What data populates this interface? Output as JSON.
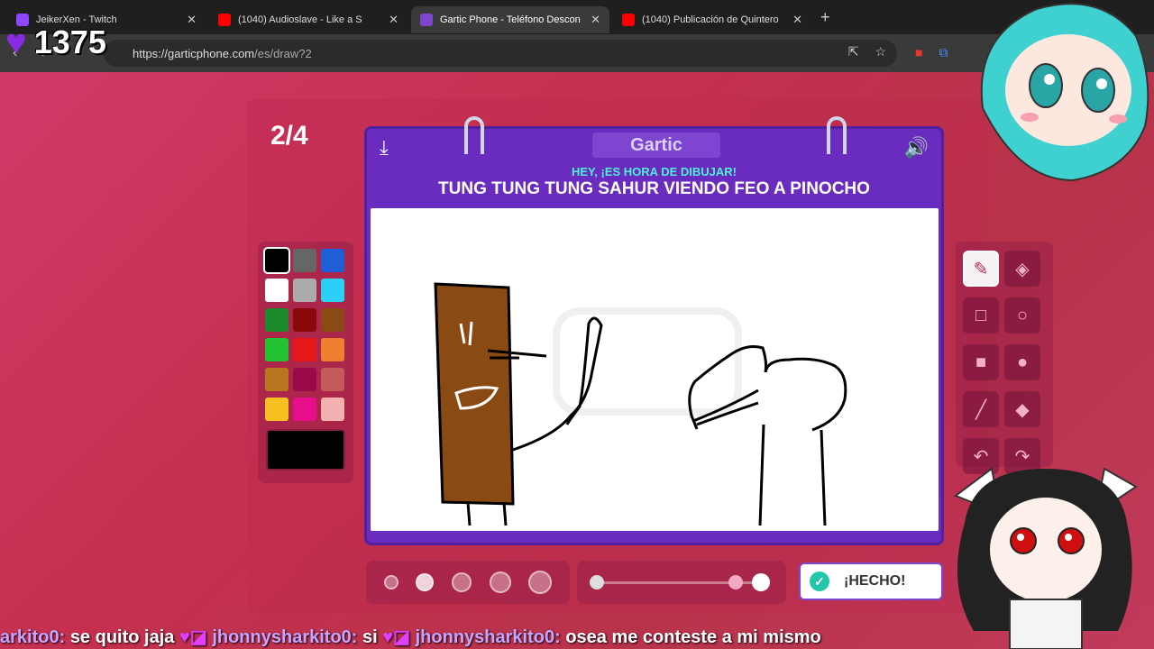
{
  "tabs": [
    {
      "title": "JeikerXen - Twitch",
      "favicon": "twitch-icon",
      "active": false
    },
    {
      "title": "(1040) Audioslave - Like a S",
      "favicon": "youtube-icon",
      "active": false
    },
    {
      "title": "Gartic Phone - Teléfono Descon",
      "favicon": "phone-icon",
      "active": true
    },
    {
      "title": "(1040) Publicación de Quintero",
      "favicon": "youtube-icon",
      "active": false
    }
  ],
  "url": {
    "host": "https://garticphone.com",
    "path": "/es/draw?2"
  },
  "stream": {
    "viewer_count": "1375"
  },
  "game": {
    "round": "2/4",
    "logo": "Gartic",
    "prompt_sub": "HEY, ¡ES HORA DE DIBUJAR!",
    "prompt_main": "TUNG TUNG TUNG SAHUR VIENDO FEO A PINOCHO",
    "done_label": "¡HECHO!",
    "watermark": "Gartic PHONE"
  },
  "palette": {
    "colors": [
      "#000000",
      "#666666",
      "#1f5fd6",
      "#ffffff",
      "#aaaaaa",
      "#2ad0f5",
      "#1a8a2a",
      "#8a0a0a",
      "#8a4a14",
      "#22c433",
      "#e81818",
      "#f08030",
      "#b8771e",
      "#9a0a48",
      "#c45a5a",
      "#f5c020",
      "#e8108a",
      "#f5b0b0"
    ],
    "selected": "#000000",
    "current": "#000000"
  },
  "tools": [
    "pen-icon",
    "eraser-icon",
    "rect-outline-icon",
    "circle-outline-icon",
    "rect-fill-icon",
    "circle-fill-icon",
    "line-icon",
    "fill-bucket-icon",
    "undo-icon",
    "redo-icon"
  ],
  "chat": [
    {
      "user": "arkito0:",
      "msg": "se quito jaja"
    },
    {
      "user": "jhonnysharkito0:",
      "msg": "si"
    },
    {
      "user": "jhonnysharkito0:",
      "msg": "osea me conteste a mi mismo"
    }
  ]
}
